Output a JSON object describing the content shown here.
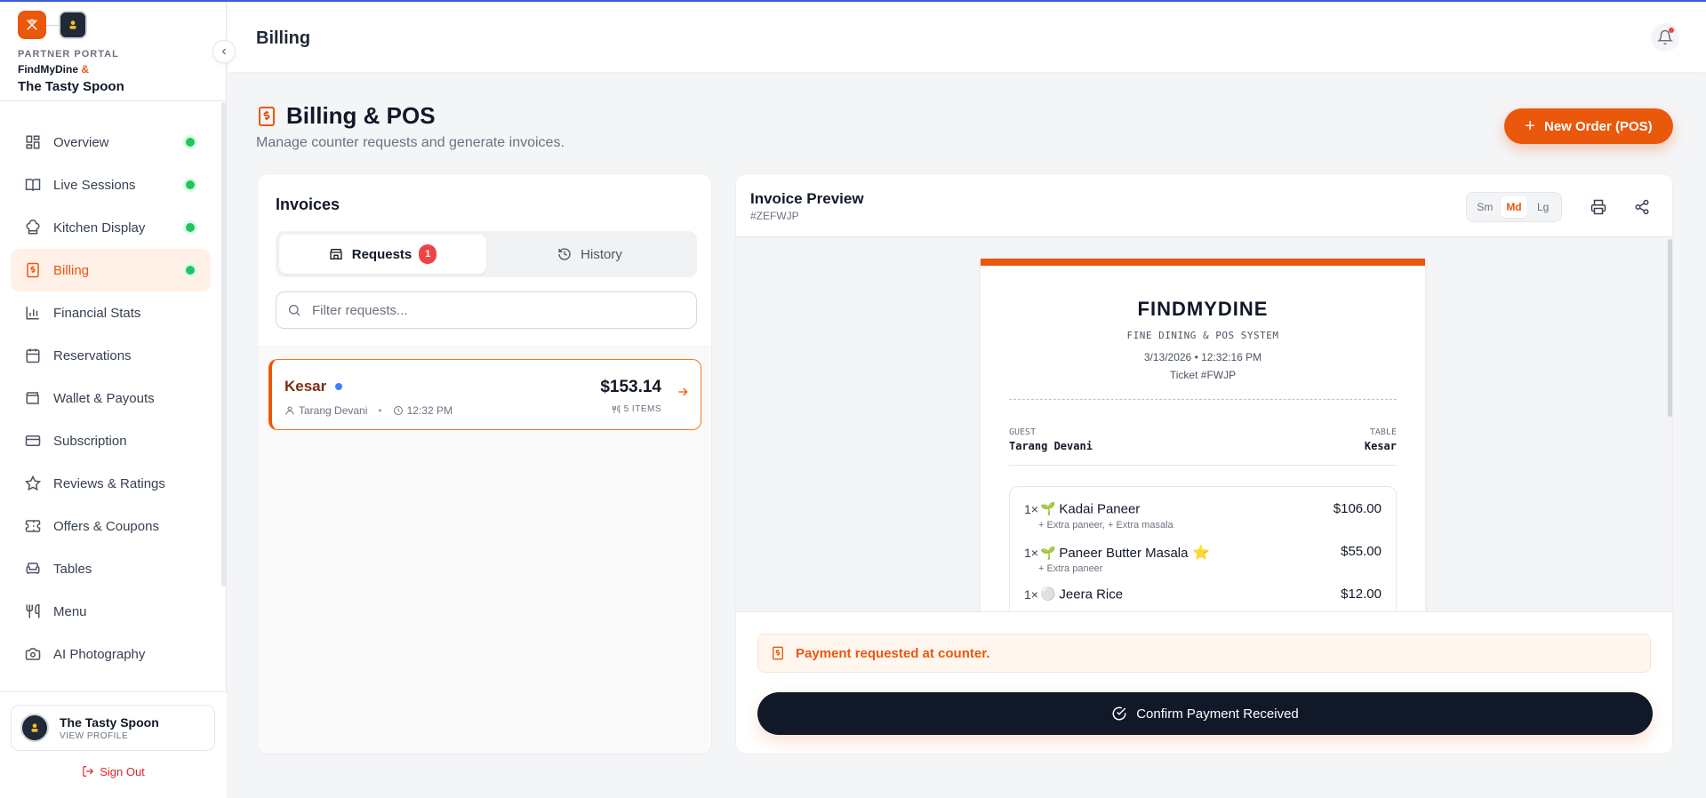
{
  "brand": {
    "portal_label": "PARTNER PORTAL",
    "line2_a": "FindMyDine",
    "line2_amp": "&",
    "restaurant": "The Tasty Spoon"
  },
  "sidebar": {
    "items": [
      {
        "label": "Overview",
        "icon": "grid-icon",
        "dot": true
      },
      {
        "label": "Live Sessions",
        "icon": "book-icon",
        "dot": true
      },
      {
        "label": "Kitchen Display",
        "icon": "kitchen-icon",
        "dot": true
      },
      {
        "label": "Billing",
        "icon": "receipt-icon",
        "dot": true,
        "active": true
      },
      {
        "label": "Financial Stats",
        "icon": "bar-chart-icon"
      },
      {
        "label": "Reservations",
        "icon": "calendar-icon"
      },
      {
        "label": "Wallet & Payouts",
        "icon": "wallet-icon"
      },
      {
        "label": "Subscription",
        "icon": "credit-card-icon"
      },
      {
        "label": "Reviews & Ratings",
        "icon": "star-icon"
      },
      {
        "label": "Offers & Coupons",
        "icon": "ticket-icon"
      },
      {
        "label": "Tables",
        "icon": "armchair-icon"
      },
      {
        "label": "Menu",
        "icon": "utensils-icon"
      },
      {
        "label": "AI Photography",
        "icon": "camera-icon"
      }
    ],
    "profile_name": "The Tasty Spoon",
    "profile_sub": "VIEW PROFILE",
    "signout": "Sign Out"
  },
  "header": {
    "title": "Billing"
  },
  "page": {
    "title": "Billing & POS",
    "subtitle": "Manage counter requests and generate invoices.",
    "new_order": "New Order (POS)"
  },
  "invoices": {
    "title": "Invoices",
    "tab_requests": "Requests",
    "requests_count": "1",
    "tab_history": "History",
    "filter_placeholder": "Filter requests...",
    "requests": [
      {
        "table": "Kesar",
        "guest": "Tarang Devani",
        "time": "12:32 PM",
        "amount": "$153.14",
        "items": "5 ITEMS"
      }
    ]
  },
  "preview": {
    "title": "Invoice Preview",
    "id": "#ZEFWJP",
    "sizes": [
      "Sm",
      "Md",
      "Lg"
    ],
    "selected_size": "Md",
    "receipt": {
      "brand": "FINDMYDINE",
      "sub": "FINE DINING & POS SYSTEM",
      "datetime": "3/13/2026 • 12:32:16 PM",
      "ticket": "Ticket #FWJP",
      "guest_label": "GUEST",
      "guest": "Tarang Devani",
      "table_label": "TABLE",
      "table": "Kesar",
      "items": [
        {
          "qty": "1×",
          "icon": "sprout-icon",
          "name": "Kadai Paneer",
          "price": "$106.00",
          "mods": "+ Extra paneer, + Extra masala"
        },
        {
          "qty": "1×",
          "icon": "sprout-icon",
          "name": "Paneer Butter Masala",
          "star": "⭐",
          "price": "$55.00",
          "mods": "+ Extra paneer"
        },
        {
          "qty": "1×",
          "icon": "plate-icon",
          "name": "Jeera Rice",
          "price": "$12.00",
          "mods": ""
        }
      ]
    },
    "payment_note": "Payment requested at counter.",
    "confirm": "Confirm Payment Received"
  },
  "colors": {
    "accent": "#ea580c",
    "dark": "#111827",
    "status_green": "#22c55e"
  }
}
